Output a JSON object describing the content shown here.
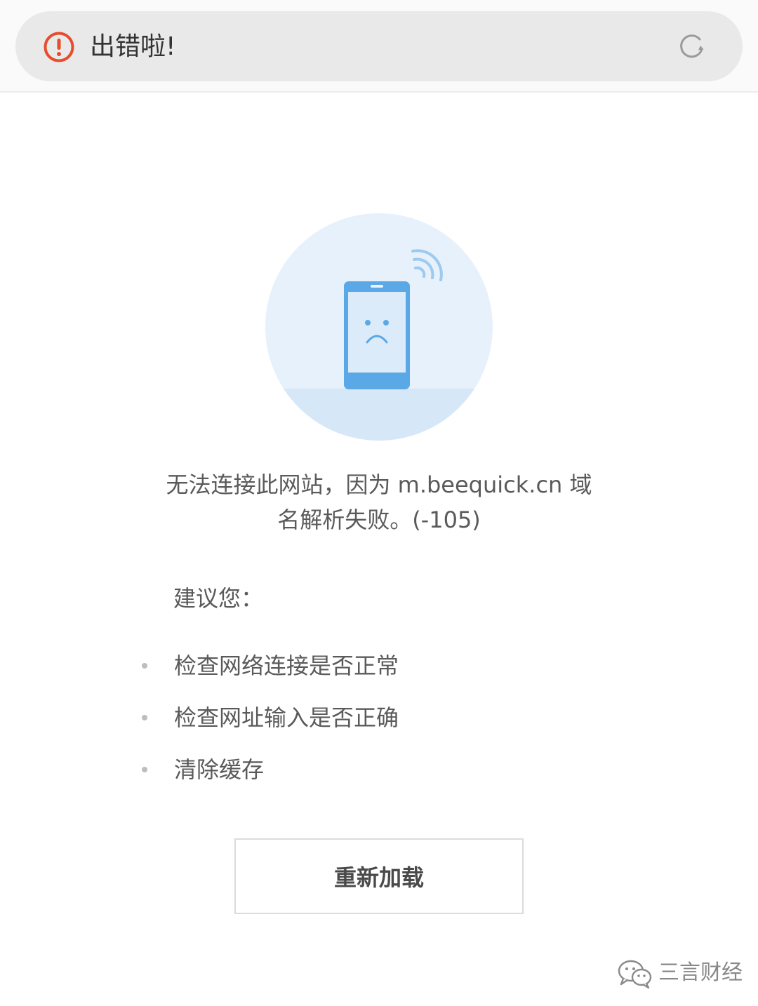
{
  "header": {
    "title": "出错啦!",
    "alert_icon": "alert-circle-icon",
    "reload_icon": "refresh-icon",
    "alert_color": "#e74c2c"
  },
  "illustration": {
    "icon": "sad-phone-signal-icon",
    "accent_color": "#5aa8e6",
    "circle_color": "#e6f1fb"
  },
  "error": {
    "message_line1": "无法连接此网站，因为 m.beequick.cn 域",
    "message_line2": "名解析失败。(-105)"
  },
  "suggestions": {
    "heading": "建议您：",
    "items": [
      "检查网络连接是否正常",
      "检查网址输入是否正确",
      "清除缓存"
    ]
  },
  "actions": {
    "reload_label": "重新加载"
  },
  "watermark": {
    "icon": "wechat-icon",
    "text": "三言财经"
  }
}
